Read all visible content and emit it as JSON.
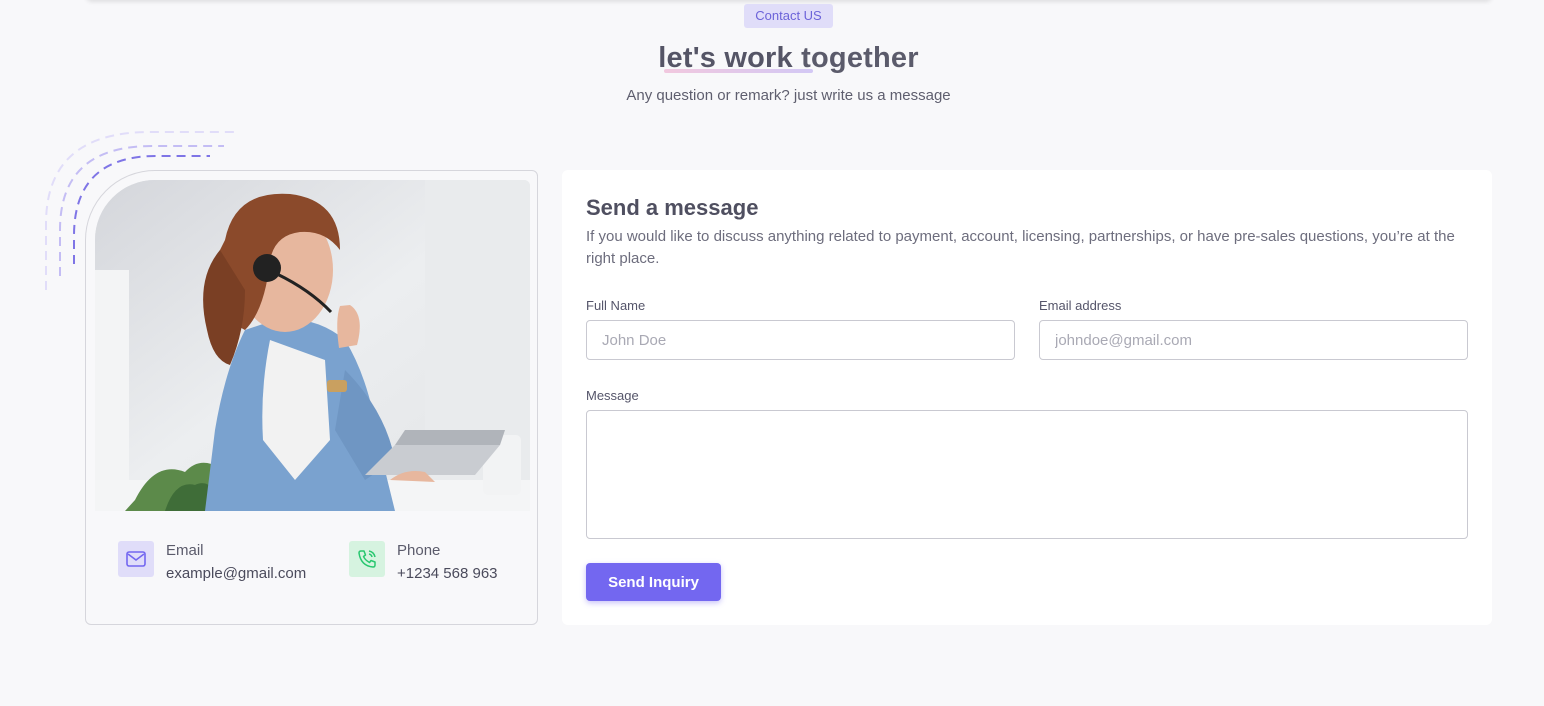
{
  "badge": "Contact US",
  "hero": {
    "title_strong": "let's work",
    "title_rest": "together",
    "subtitle": "Any question or remark? just write us a message"
  },
  "contact": {
    "email": {
      "label": "Email",
      "value": "example@gmail.com",
      "icon": "mail-icon"
    },
    "phone": {
      "label": "Phone",
      "value": "+1234 568 963",
      "icon": "phone-icon"
    }
  },
  "form": {
    "title": "Send a message",
    "description": "If you would like to discuss anything related to payment, account, licensing, partnerships, or have pre-sales questions, you’re at the right place.",
    "full_name": {
      "label": "Full Name",
      "placeholder": "John Doe"
    },
    "email": {
      "label": "Email address",
      "placeholder": "johndoe@gmail.com"
    },
    "message": {
      "label": "Message",
      "placeholder": ""
    },
    "submit_label": "Send Inquiry"
  },
  "colors": {
    "primary": "#7367f0",
    "badge_bg": "#e0ddf9",
    "email_icon_bg": "#e0ddf9",
    "phone_icon_bg": "#d6f3e0",
    "phone_icon": "#28c76f"
  }
}
